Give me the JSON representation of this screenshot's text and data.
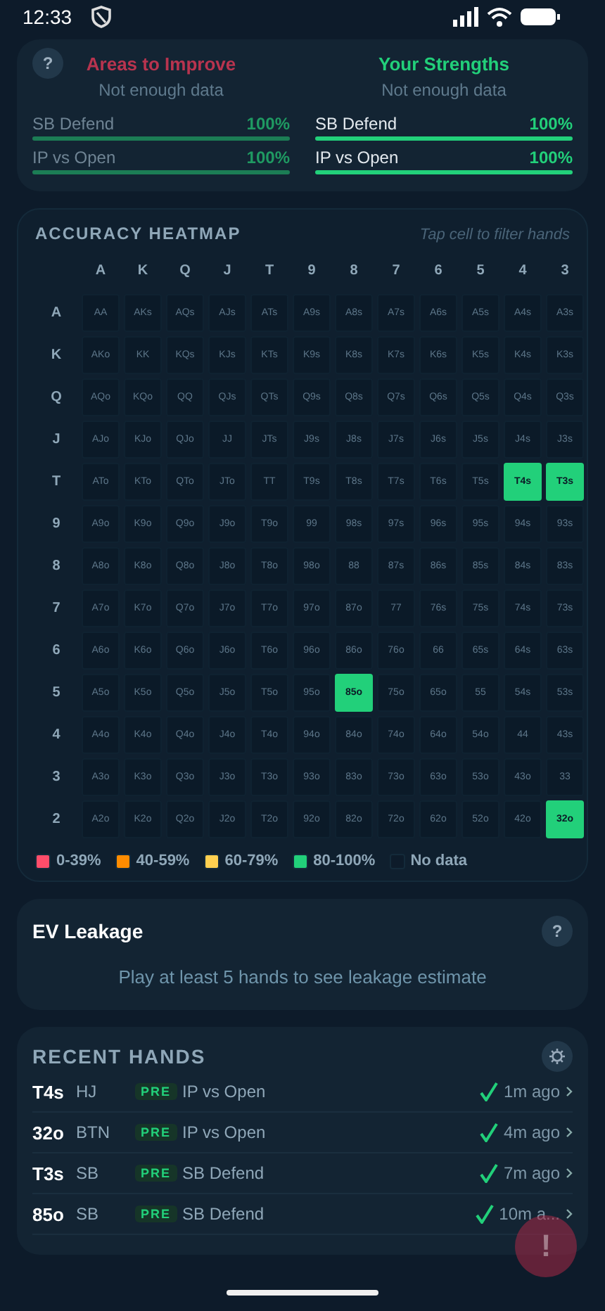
{
  "status_bar": {
    "time": "12:33"
  },
  "summary": {
    "help": "?",
    "columns": [
      {
        "kind": "improve",
        "title": "Areas to Improve",
        "note": "Not enough data",
        "dimmed": true,
        "items": [
          {
            "label": "SB Defend",
            "value": "100%",
            "level": 1
          },
          {
            "label": "IP vs Open",
            "value": "100%",
            "level": 1
          }
        ]
      },
      {
        "kind": "strength",
        "title": "Your Strengths",
        "note": "Not enough data",
        "dimmed": false,
        "items": [
          {
            "label": "SB Defend",
            "value": "100%",
            "level": 1
          },
          {
            "label": "IP vs Open",
            "value": "100%",
            "level": 1
          }
        ]
      }
    ]
  },
  "heatmap": {
    "title": "ACCURACY HEATMAP",
    "hint": "Tap cell to filter hands",
    "column_labels": [
      "A",
      "K",
      "Q",
      "J",
      "T",
      "9",
      "8",
      "7",
      "6",
      "5",
      "4",
      "3"
    ],
    "rows": [
      {
        "label": "A",
        "cells": [
          {
            "label": "AA"
          },
          {
            "label": "AKs"
          },
          {
            "label": "AQs"
          },
          {
            "label": "AJs"
          },
          {
            "label": "ATs"
          },
          {
            "label": "A9s"
          },
          {
            "label": "A8s"
          },
          {
            "label": "A7s"
          },
          {
            "label": "A6s"
          },
          {
            "label": "A5s"
          },
          {
            "label": "A4s"
          },
          {
            "label": "A3s"
          }
        ]
      },
      {
        "label": "K",
        "cells": [
          {
            "label": "AKo"
          },
          {
            "label": "KK"
          },
          {
            "label": "KQs"
          },
          {
            "label": "KJs"
          },
          {
            "label": "KTs"
          },
          {
            "label": "K9s"
          },
          {
            "label": "K8s"
          },
          {
            "label": "K7s"
          },
          {
            "label": "K6s"
          },
          {
            "label": "K5s"
          },
          {
            "label": "K4s"
          },
          {
            "label": "K3s"
          }
        ]
      },
      {
        "label": "Q",
        "cells": [
          {
            "label": "AQo"
          },
          {
            "label": "KQo"
          },
          {
            "label": "QQ"
          },
          {
            "label": "QJs"
          },
          {
            "label": "QTs"
          },
          {
            "label": "Q9s"
          },
          {
            "label": "Q8s"
          },
          {
            "label": "Q7s"
          },
          {
            "label": "Q6s"
          },
          {
            "label": "Q5s"
          },
          {
            "label": "Q4s"
          },
          {
            "label": "Q3s"
          }
        ]
      },
      {
        "label": "J",
        "cells": [
          {
            "label": "AJo"
          },
          {
            "label": "KJo"
          },
          {
            "label": "QJo"
          },
          {
            "label": "JJ"
          },
          {
            "label": "JTs"
          },
          {
            "label": "J9s"
          },
          {
            "label": "J8s"
          },
          {
            "label": "J7s"
          },
          {
            "label": "J6s"
          },
          {
            "label": "J5s"
          },
          {
            "label": "J4s"
          },
          {
            "label": "J3s"
          }
        ]
      },
      {
        "label": "T",
        "cells": [
          {
            "label": "ATo"
          },
          {
            "label": "KTo"
          },
          {
            "label": "QTo"
          },
          {
            "label": "JTo"
          },
          {
            "label": "TT"
          },
          {
            "label": "T9s"
          },
          {
            "label": "T8s"
          },
          {
            "label": "T7s"
          },
          {
            "label": "T6s"
          },
          {
            "label": "T5s"
          },
          {
            "label": "T4s",
            "color": "#22d07a"
          },
          {
            "label": "T3s",
            "color": "#22d07a"
          }
        ]
      },
      {
        "label": "9",
        "cells": [
          {
            "label": "A9o"
          },
          {
            "label": "K9o"
          },
          {
            "label": "Q9o"
          },
          {
            "label": "J9o"
          },
          {
            "label": "T9o"
          },
          {
            "label": "99"
          },
          {
            "label": "98s"
          },
          {
            "label": "97s"
          },
          {
            "label": "96s"
          },
          {
            "label": "95s"
          },
          {
            "label": "94s"
          },
          {
            "label": "93s"
          }
        ]
      },
      {
        "label": "8",
        "cells": [
          {
            "label": "A8o"
          },
          {
            "label": "K8o"
          },
          {
            "label": "Q8o"
          },
          {
            "label": "J8o"
          },
          {
            "label": "T8o"
          },
          {
            "label": "98o"
          },
          {
            "label": "88"
          },
          {
            "label": "87s"
          },
          {
            "label": "86s"
          },
          {
            "label": "85s"
          },
          {
            "label": "84s"
          },
          {
            "label": "83s"
          }
        ]
      },
      {
        "label": "7",
        "cells": [
          {
            "label": "A7o"
          },
          {
            "label": "K7o"
          },
          {
            "label": "Q7o"
          },
          {
            "label": "J7o"
          },
          {
            "label": "T7o"
          },
          {
            "label": "97o"
          },
          {
            "label": "87o"
          },
          {
            "label": "77"
          },
          {
            "label": "76s"
          },
          {
            "label": "75s"
          },
          {
            "label": "74s"
          },
          {
            "label": "73s"
          }
        ]
      },
      {
        "label": "6",
        "cells": [
          {
            "label": "A6o"
          },
          {
            "label": "K6o"
          },
          {
            "label": "Q6o"
          },
          {
            "label": "J6o"
          },
          {
            "label": "T6o"
          },
          {
            "label": "96o"
          },
          {
            "label": "86o"
          },
          {
            "label": "76o"
          },
          {
            "label": "66"
          },
          {
            "label": "65s"
          },
          {
            "label": "64s"
          },
          {
            "label": "63s"
          }
        ]
      },
      {
        "label": "5",
        "cells": [
          {
            "label": "A5o"
          },
          {
            "label": "K5o"
          },
          {
            "label": "Q5o"
          },
          {
            "label": "J5o"
          },
          {
            "label": "T5o"
          },
          {
            "label": "95o"
          },
          {
            "label": "85o",
            "color": "#22d07a"
          },
          {
            "label": "75o"
          },
          {
            "label": "65o"
          },
          {
            "label": "55"
          },
          {
            "label": "54s"
          },
          {
            "label": "53s"
          }
        ]
      },
      {
        "label": "4",
        "cells": [
          {
            "label": "A4o"
          },
          {
            "label": "K4o"
          },
          {
            "label": "Q4o"
          },
          {
            "label": "J4o"
          },
          {
            "label": "T4o"
          },
          {
            "label": "94o"
          },
          {
            "label": "84o"
          },
          {
            "label": "74o"
          },
          {
            "label": "64o"
          },
          {
            "label": "54o"
          },
          {
            "label": "44"
          },
          {
            "label": "43s"
          }
        ]
      },
      {
        "label": "3",
        "cells": [
          {
            "label": "A3o"
          },
          {
            "label": "K3o"
          },
          {
            "label": "Q3o"
          },
          {
            "label": "J3o"
          },
          {
            "label": "T3o"
          },
          {
            "label": "93o"
          },
          {
            "label": "83o"
          },
          {
            "label": "73o"
          },
          {
            "label": "63o"
          },
          {
            "label": "53o"
          },
          {
            "label": "43o"
          },
          {
            "label": "33"
          }
        ]
      },
      {
        "label": "2",
        "cells": [
          {
            "label": "A2o"
          },
          {
            "label": "K2o"
          },
          {
            "label": "Q2o"
          },
          {
            "label": "J2o"
          },
          {
            "label": "T2o"
          },
          {
            "label": "92o"
          },
          {
            "label": "82o"
          },
          {
            "label": "72o"
          },
          {
            "label": "62o"
          },
          {
            "label": "52o"
          },
          {
            "label": "42o"
          },
          {
            "label": "32o",
            "color": "#22d07a"
          }
        ]
      }
    ],
    "legend": [
      {
        "label": "0-39%",
        "color": "#ff4d6a"
      },
      {
        "label": "40-59%",
        "color": "#ff8c00"
      },
      {
        "label": "60-79%",
        "color": "#ffd050"
      },
      {
        "label": "80-100%",
        "color": "#22d07a"
      },
      {
        "label": "No data",
        "color": "#0d1b2a"
      }
    ]
  },
  "ev_leakage": {
    "title": "EV Leakage",
    "help": "?",
    "message": "Play at least 5 hands to see leakage estimate"
  },
  "recent_hands": {
    "title": "RECENT HANDS",
    "rows": [
      {
        "hand": "T4s",
        "position": "HJ",
        "street": "PRE",
        "spot": "IP vs Open",
        "correct": true,
        "time": "1m ago"
      },
      {
        "hand": "32o",
        "position": "BTN",
        "street": "PRE",
        "spot": "IP vs Open",
        "correct": true,
        "time": "4m ago"
      },
      {
        "hand": "T3s",
        "position": "SB",
        "street": "PRE",
        "spot": "SB Defend",
        "correct": true,
        "time": "7m ago"
      },
      {
        "hand": "85o",
        "position": "SB",
        "street": "PRE",
        "spot": "SB Defend",
        "correct": true,
        "time": "10m a..."
      }
    ]
  },
  "fab": {
    "label": "!"
  }
}
